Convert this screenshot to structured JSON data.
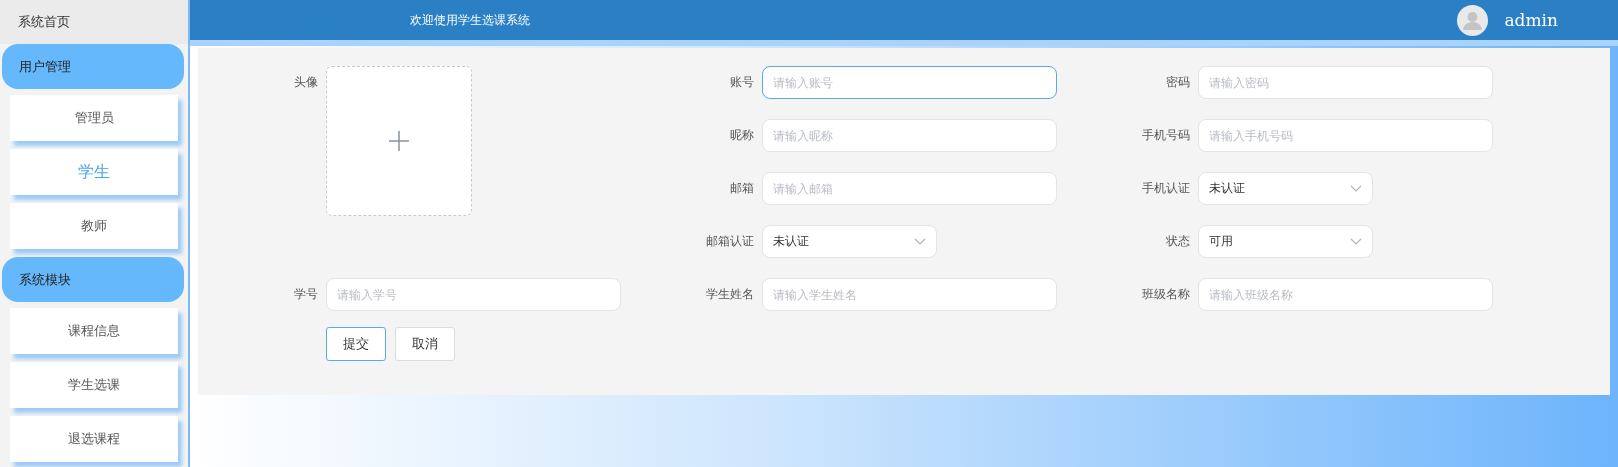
{
  "sidebar": {
    "home": "系统首页",
    "groups": [
      {
        "title": "用户管理",
        "items": [
          {
            "label": "管理员",
            "selected": false
          },
          {
            "label": "学生",
            "selected": true
          },
          {
            "label": "教师",
            "selected": false
          }
        ]
      },
      {
        "title": "系统模块",
        "items": [
          {
            "label": "课程信息",
            "selected": false
          },
          {
            "label": "学生选课",
            "selected": false
          },
          {
            "label": "退选课程",
            "selected": false
          }
        ]
      }
    ]
  },
  "header": {
    "title": "欢迎使用学生选课系统",
    "user": "admin"
  },
  "form": {
    "fields": [
      {
        "kind": "upload",
        "label": "头像"
      },
      {
        "kind": "text",
        "label": "账号",
        "placeholder": "请输入账号",
        "focused": true
      },
      {
        "kind": "text",
        "label": "密码",
        "placeholder": "请输入密码",
        "focused": false
      },
      {
        "kind": "text",
        "label": "昵称",
        "placeholder": "请输入昵称",
        "focused": false
      },
      {
        "kind": "text",
        "label": "手机号码",
        "placeholder": "请输入手机号码",
        "focused": false
      },
      {
        "kind": "text",
        "label": "邮箱",
        "placeholder": "请输入邮箱",
        "focused": false
      },
      {
        "kind": "select",
        "label": "手机认证",
        "value": "未认证"
      },
      {
        "kind": "select",
        "label": "邮箱认证",
        "value": "未认证"
      },
      {
        "kind": "select",
        "label": "状态",
        "value": "可用"
      },
      {
        "kind": "text",
        "label": "学号",
        "placeholder": "请输入学号",
        "focused": false
      },
      {
        "kind": "text",
        "label": "学生姓名",
        "placeholder": "请输入学生姓名",
        "focused": false
      },
      {
        "kind": "text",
        "label": "班级名称",
        "placeholder": "请输入班级名称",
        "focused": false
      }
    ],
    "buttons": [
      {
        "label": "提交",
        "kind": "primary"
      },
      {
        "label": "取消",
        "kind": "plain"
      }
    ]
  }
}
